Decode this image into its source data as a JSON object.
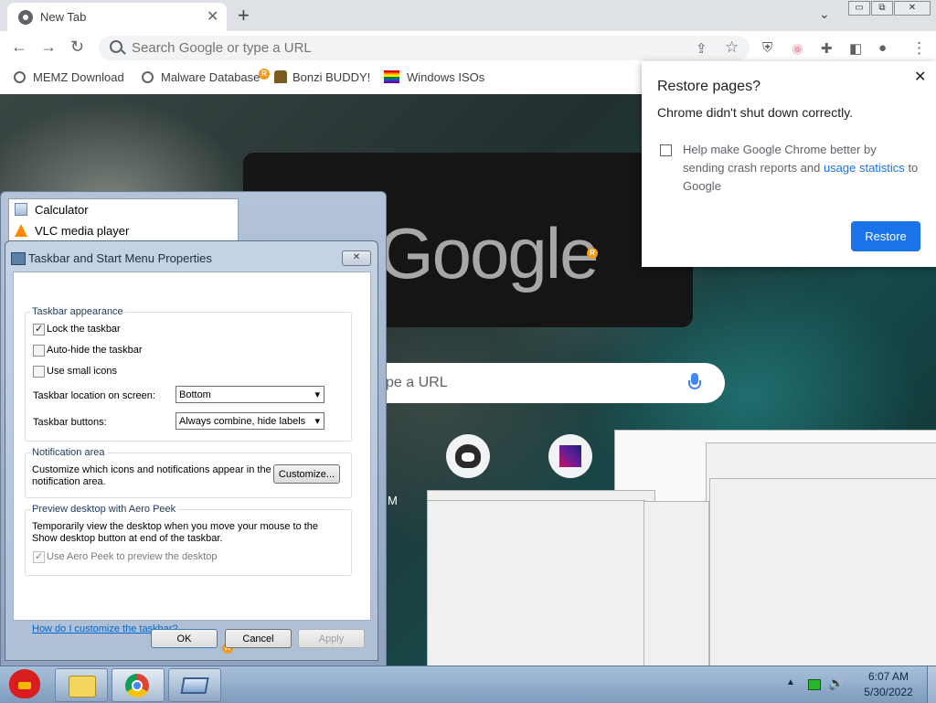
{
  "browser": {
    "tab": {
      "title": "New Tab",
      "close_glyph": "✕"
    },
    "new_tab_glyph": "+",
    "tab_search_glyph": "⌄",
    "window_buttons": [
      "▭",
      "⧉",
      "✕"
    ],
    "nav": {
      "back": "←",
      "forward": "→",
      "reload": "↻"
    },
    "omnibox": {
      "placeholder": "Search Google or type a URL"
    },
    "toolbar_icons": [
      "share-icon",
      "star-icon",
      "ublock-icon",
      "flag-extension-icon",
      "puzzle-icon",
      "side-panel-icon",
      "profile-icon",
      "menu-icon"
    ],
    "toolbar_glyphs": {
      "share": "⇪",
      "star": "☆",
      "ublock": "⛨",
      "flag": "◉",
      "puzzle": "✚",
      "side_panel": "◧",
      "profile": "●",
      "menu": "⋮"
    },
    "bookmarks": [
      {
        "label": "MEMZ Download",
        "icon": "globe-icon"
      },
      {
        "label": "Malware Database",
        "icon": "globe-icon"
      },
      {
        "label": "Bonzi BUDDY!",
        "icon": "bonzi-icon"
      },
      {
        "label": "Windows ISOs",
        "icon": "rainbow-flag-icon"
      }
    ]
  },
  "ntp": {
    "logo": "Google",
    "search_placeholder": "pe a URL",
    "shortcut_letter": "M"
  },
  "restore_popup": {
    "title": "Restore pages?",
    "close_glyph": "✕",
    "message": "Chrome didn't shut down correctly.",
    "help_text": "Help make Google Chrome better by sending crash reports and",
    "link_text": "usage statistics",
    "help_suffix": "to Google",
    "button": "Restore",
    "accent": "#1a73e8"
  },
  "start_menu": {
    "items": [
      {
        "label": "Calculator",
        "icon": "calculator-icon"
      },
      {
        "label": "VLC media player",
        "icon": "vlc-icon"
      }
    ]
  },
  "dialog": {
    "title": "Taskbar and Start Menu Properties",
    "close_glyph": "✕",
    "appearance": {
      "group_label": "Taskbar appearance",
      "lock_taskbar": {
        "label": "Lock the taskbar",
        "checked": true
      },
      "auto_hide": {
        "label": "Auto-hide the taskbar",
        "checked": false
      },
      "small_icons": {
        "label": "Use small icons",
        "checked": false
      },
      "location": {
        "label": "Taskbar location on screen:",
        "value": "Bottom"
      },
      "buttons": {
        "label": "Taskbar buttons:",
        "value": "Always combine, hide labels"
      }
    },
    "notification": {
      "group_label": "Notification area",
      "text": "Customize which icons and notifications appear in the notification area.",
      "button": "Customize..."
    },
    "peek": {
      "group_label": "Preview desktop with Aero Peek",
      "text": "Temporarily view the desktop when you move your mouse to the Show desktop button at end of the taskbar.",
      "checkbox": {
        "label": "Use Aero Peek to preview the desktop",
        "checked": true
      }
    },
    "help_link": "How do I customize the taskbar?",
    "ok": "OK",
    "cancel": "Cancel",
    "apply": "Apply"
  },
  "taskbar": {
    "start_icon": "angry-bird-start-icon",
    "pinned": [
      "explorer-icon",
      "chrome-icon",
      "window-icon"
    ],
    "tray": {
      "up_arrow": "▲",
      "volume": "🔊"
    },
    "time": "6:07 AM",
    "date": "5/30/2022"
  },
  "badge_letter": "R"
}
